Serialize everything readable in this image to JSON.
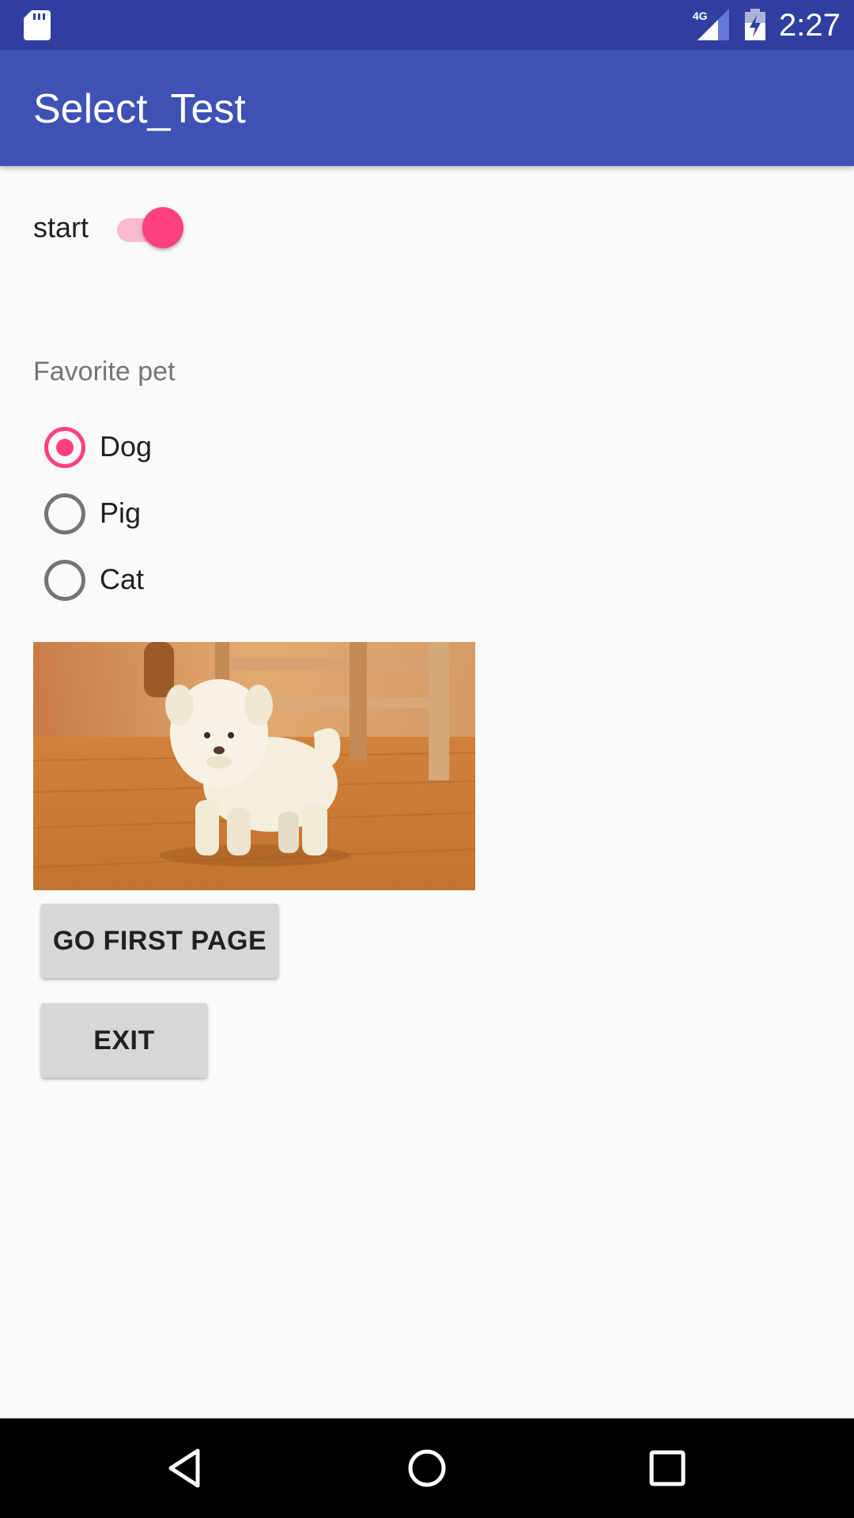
{
  "status_bar": {
    "time": "2:27",
    "network": "4G",
    "icons": [
      "sd-card-icon",
      "signal-4g-icon",
      "battery-charging-icon"
    ]
  },
  "app_bar": {
    "title": "Select_Test"
  },
  "switch": {
    "label": "start",
    "checked": true
  },
  "radio_group": {
    "label": "Favorite pet",
    "options": [
      {
        "label": "Dog",
        "checked": true
      },
      {
        "label": "Pig",
        "checked": false
      },
      {
        "label": "Cat",
        "checked": false
      }
    ]
  },
  "image": {
    "subject": "white puppy on wooden floor"
  },
  "buttons": {
    "first_page": "GO FIRST PAGE",
    "exit": "EXIT"
  },
  "nav_bar": {
    "icons": [
      "back-icon",
      "home-icon",
      "recents-icon"
    ]
  },
  "colors": {
    "status_bar": "#303F9F",
    "app_bar": "#3F51B5",
    "accent": "#FF4081",
    "background": "#FAFAFA",
    "button": "#D6D7D7"
  }
}
